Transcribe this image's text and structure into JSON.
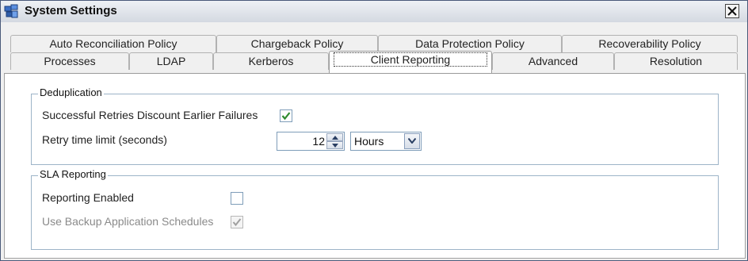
{
  "window": {
    "title": "System Settings",
    "icon": "app-settings-icon",
    "close_icon": "close-icon"
  },
  "tabs": {
    "row1": [
      "Auto Reconciliation Policy",
      "Chargeback Policy",
      "Data Protection Policy",
      "Recoverability Policy"
    ],
    "row2": [
      "Processes",
      "LDAP",
      "Kerberos",
      "Client Reporting",
      "Advanced",
      "Resolution"
    ],
    "active": "Client Reporting"
  },
  "deduplication": {
    "title": "Deduplication",
    "retries_label": "Successful Retries Discount Earlier Failures",
    "retries_checked": true,
    "retry_limit_label": "Retry time limit (seconds)",
    "retry_limit_value": "12",
    "retry_unit": "Hours"
  },
  "sla_reporting": {
    "title": "SLA Reporting",
    "reporting_enabled_label": "Reporting Enabled",
    "reporting_enabled_checked": false,
    "use_backup_label": "Use Backup Application Schedules",
    "use_backup_checked": true,
    "use_backup_disabled": true
  },
  "colors": {
    "check_green": "#2e8b2e",
    "check_disabled": "#a0a0a0",
    "group_border": "#9db4c8"
  }
}
